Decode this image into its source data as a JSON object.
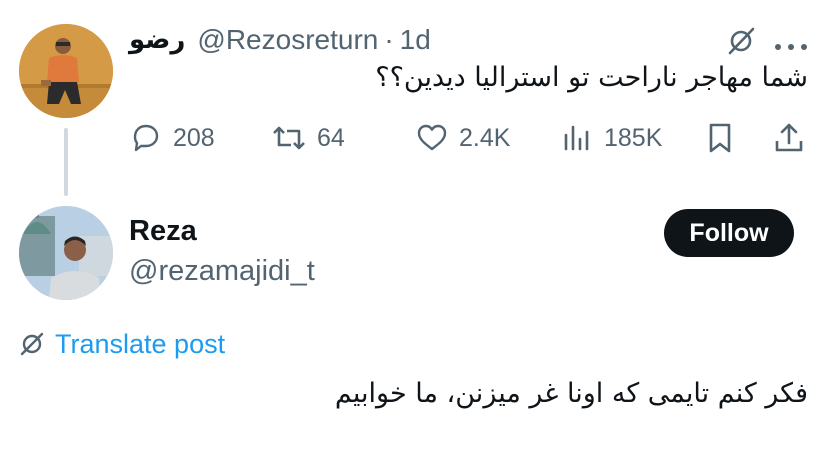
{
  "colors": {
    "text": "#0f1419",
    "secondary": "#536471",
    "link": "#1d9bf0",
    "button_bg": "#0f1419",
    "button_text": "#ffffff",
    "thread_line": "#cfd9de"
  },
  "quoted_post": {
    "display_name": "رضو",
    "handle": "@Rezosreturn",
    "separator": "·",
    "time": "1d",
    "text": "شما مهاجر ناراحت تو استرالیا دیدین؟؟",
    "icons": [
      "grok-icon",
      "more-icon"
    ],
    "actions": {
      "replies": "208",
      "reposts": "64",
      "likes": "2.4K",
      "views": "185K"
    }
  },
  "reply_post": {
    "display_name": "Reza",
    "handle": "@rezamajidi_t",
    "follow_label": "Follow",
    "translate_label": "Translate post",
    "text": "فکر کنم تایمی که اونا غر میزنن، ما خوابیم"
  }
}
